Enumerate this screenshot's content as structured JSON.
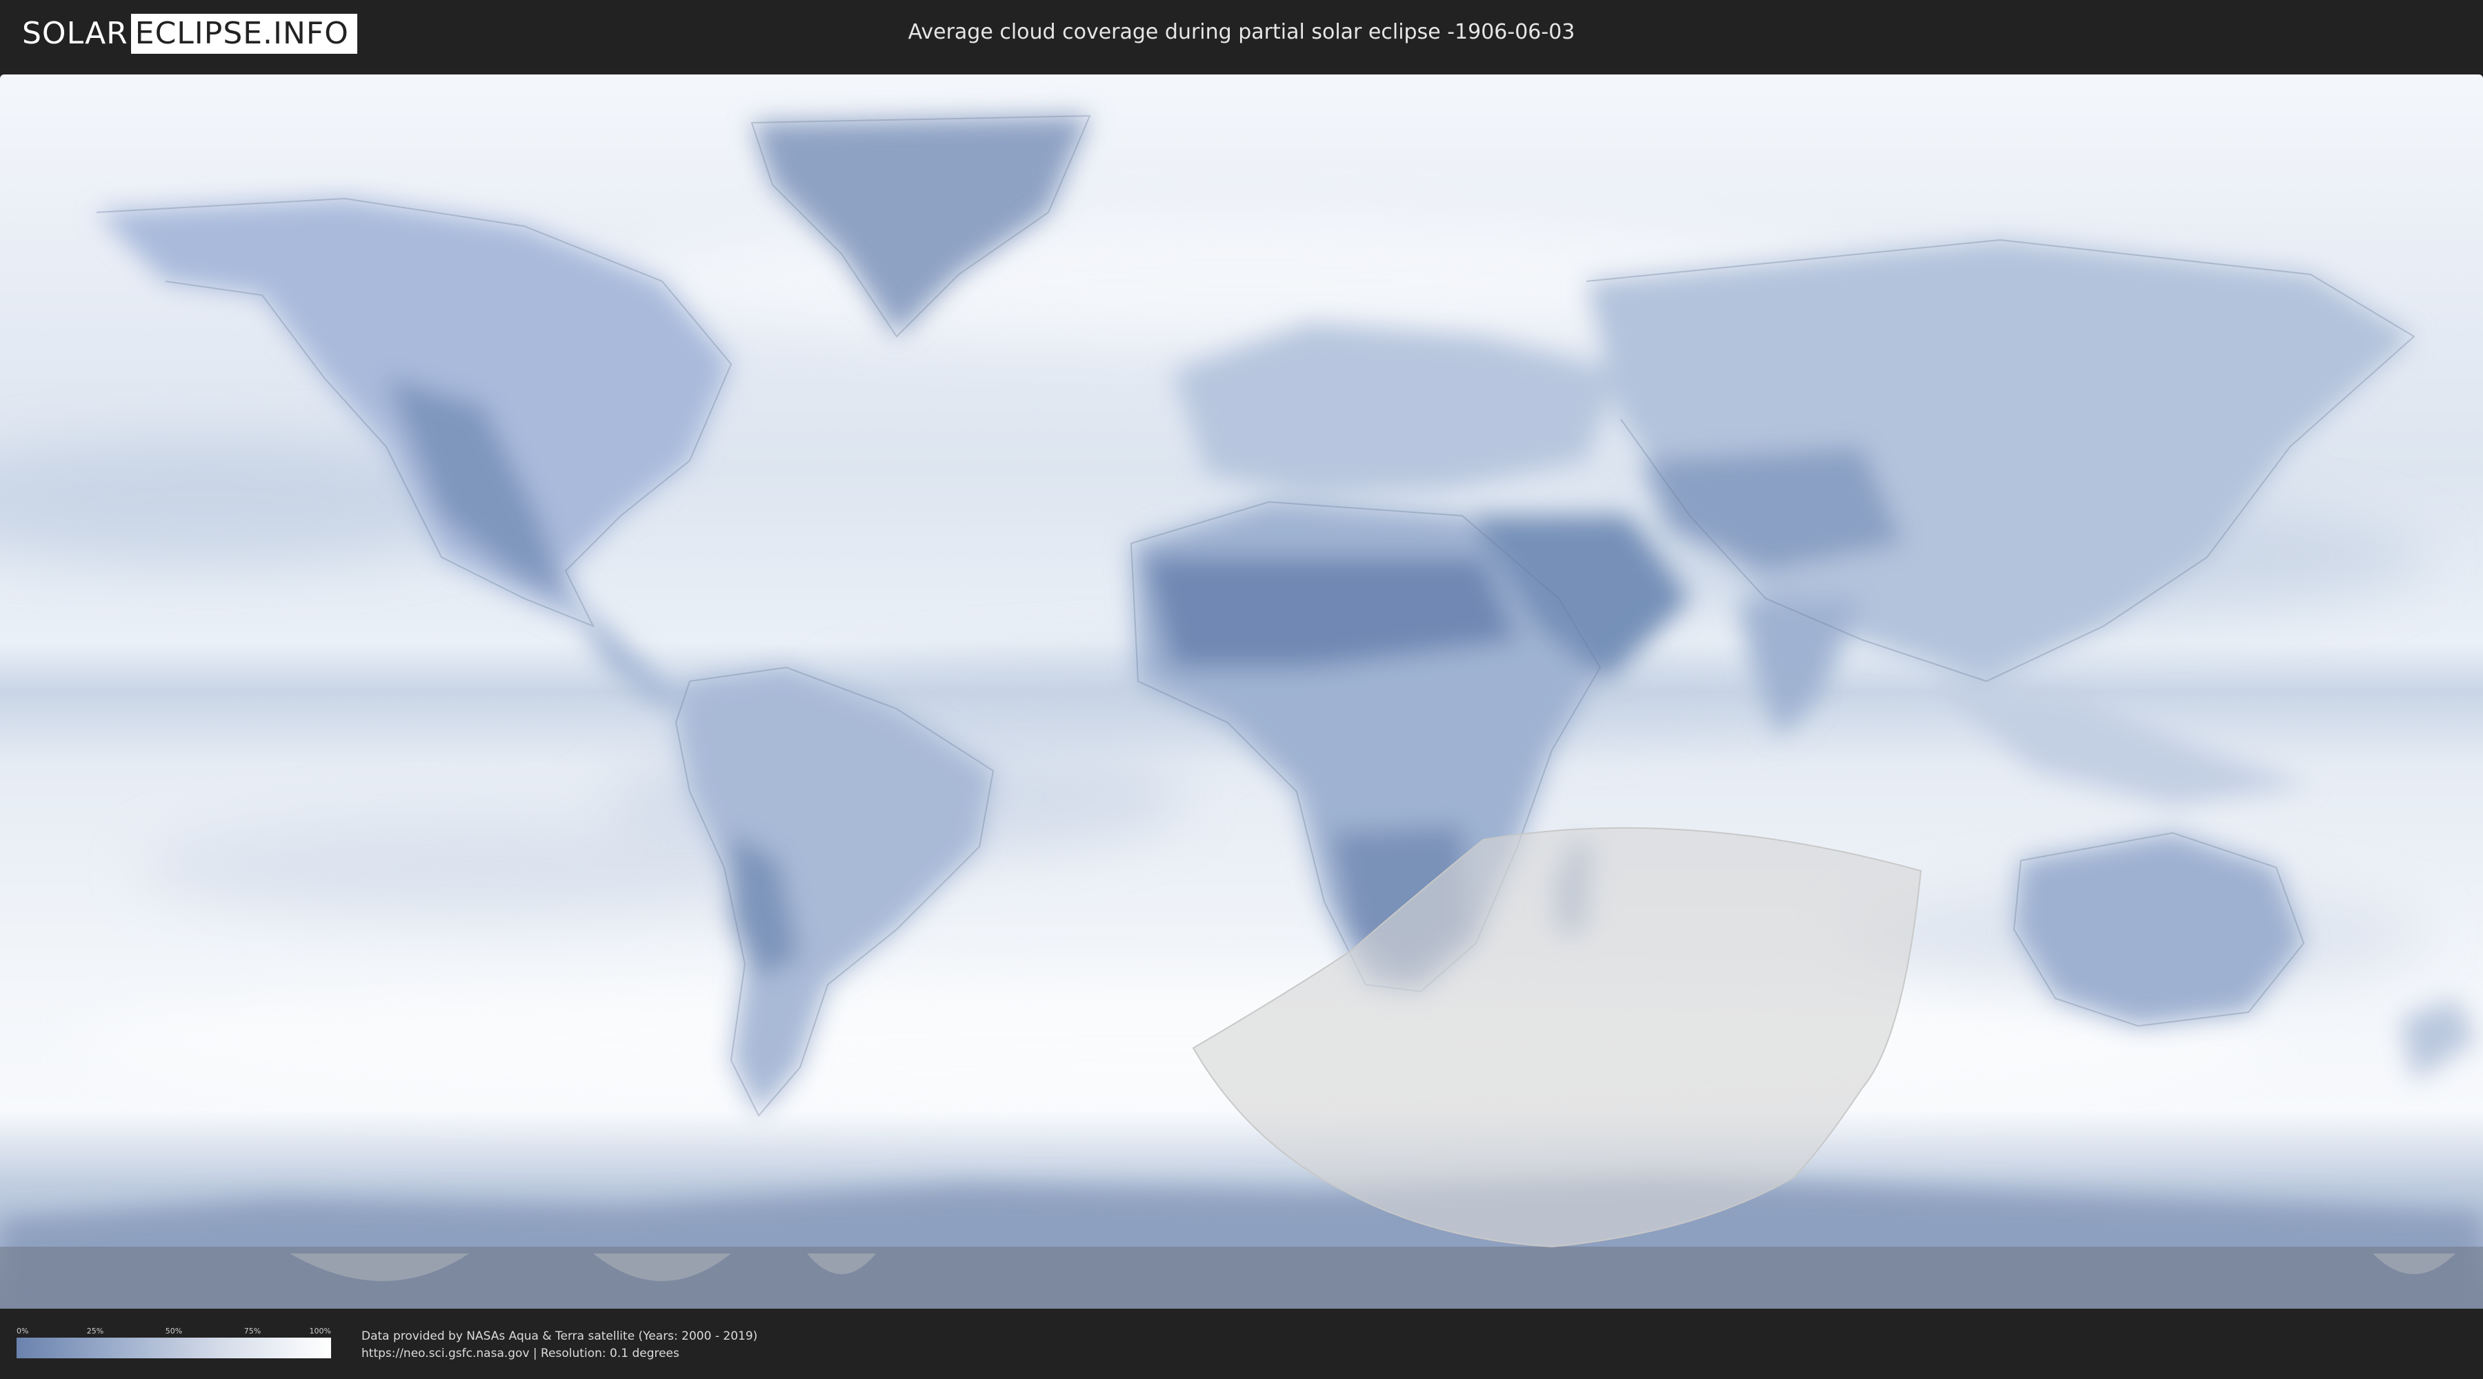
{
  "header": {
    "logo_part1": "SOLAR",
    "logo_part2": "ECLIPSE.INFO",
    "title": "Average cloud coverage during partial solar eclipse -1906-06-03"
  },
  "legend": {
    "ticks": [
      "0%",
      "25%",
      "50%",
      "75%",
      "100%"
    ],
    "gradient": [
      "#6a82ad",
      "#9aaccb",
      "#d5dce9",
      "#ffffff"
    ]
  },
  "credits": {
    "line1": "Data provided by NASAs Aqua & Terra satellite (Years: 2000 - 2019)",
    "line2": "https://neo.sci.gsfc.nasa.gov | Resolution: 0.1 degrees"
  },
  "colors": {
    "background": "#222222",
    "clear_sky": "#7a93bb",
    "cloudy": "#ffffff",
    "eclipse_overlay": "#d6d6d6"
  },
  "map": {
    "eclipse_visibility_region": "partial eclipse zone"
  }
}
